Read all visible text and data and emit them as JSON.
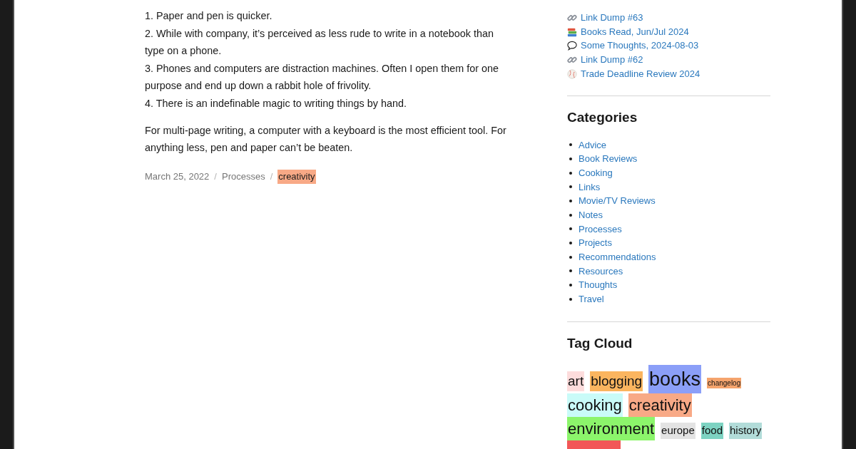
{
  "post": {
    "list_items": [
      "1. Paper and pen is quicker.",
      "2. While with company, it’s perceived as less rude to write in a notebook than type on a phone.",
      "3. Phones and computers are distraction machines. Often I open them for one purpose and end up down a rabbit hole of frivolity.",
      "4. There is an indefinable magic to writing things by hand."
    ],
    "paragraph": "For multi-page writing, a computer with a keyboard is the most efficient tool. For anything less, pen and paper can’t be beaten.",
    "meta": [
      {
        "kind": "date",
        "text": "March 25, 2022"
      },
      {
        "kind": "separator",
        "text": "/"
      },
      {
        "kind": "category",
        "text": "Processes"
      },
      {
        "kind": "separator",
        "text": "/"
      },
      {
        "kind": "tag",
        "text": "creativity",
        "color": "#f8a986"
      }
    ]
  },
  "sidebar": {
    "recent_posts": [
      {
        "kind": "link",
        "title": "Link Dump #63"
      },
      {
        "kind": "books",
        "title": "Books Read, Jun/Jul 2024"
      },
      {
        "kind": "thought",
        "title": "Some Thoughts, 2024-08-03"
      },
      {
        "kind": "link",
        "title": "Link Dump #62"
      },
      {
        "kind": "baseball",
        "title": "Trade Deadline Review 2024"
      }
    ],
    "categories": {
      "title": "Categories",
      "items": [
        "Advice",
        "Book Reviews",
        "Cooking",
        "Links",
        "Movie/TV Reviews",
        "Notes",
        "Processes",
        "Projects",
        "Recommendations",
        "Resources",
        "Thoughts",
        "Travel"
      ]
    },
    "tag_cloud": {
      "title": "Tag Cloud",
      "tags": [
        {
          "label": "art",
          "kind": "medium",
          "color": "#fddcdc"
        },
        {
          "label": "blogging",
          "kind": "medium",
          "color": "#fbb55f"
        },
        {
          "label": "books",
          "kind": "huge",
          "color": "#8b9ff8"
        },
        {
          "label": "changelog",
          "kind": "tiny",
          "color": "#f5a46d"
        },
        {
          "label": "cooking",
          "kind": "large",
          "color": "#c9fbf8"
        },
        {
          "label": "creativity",
          "kind": "large",
          "color": "#f8a986"
        },
        {
          "label": "environment",
          "kind": "large",
          "color": "#8cf56b"
        },
        {
          "label": "europe",
          "kind": "small",
          "color": "#e3e3e3"
        },
        {
          "label": "food",
          "kind": "small",
          "color": "#7dd3c2"
        },
        {
          "label": "history",
          "kind": "small",
          "color": "#b2dcd9"
        },
        {
          "kind": "large",
          "color": "#f25757"
        }
      ]
    }
  }
}
